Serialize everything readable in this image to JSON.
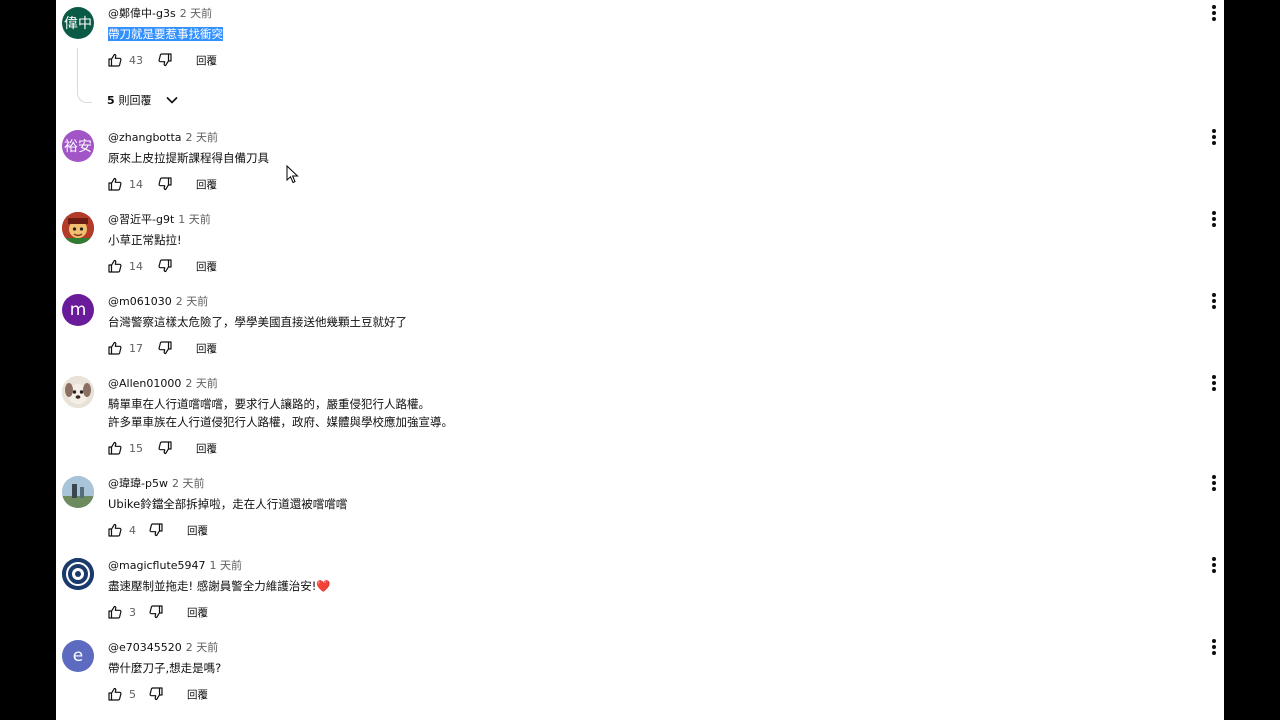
{
  "comments": [
    {
      "author": "@鄭偉中-g3s",
      "time": "2 天前",
      "lines": [
        "帶刀就是要惹事找衝突"
      ],
      "likes": "43",
      "reply_label": "回覆",
      "avatar": {
        "type": "initials",
        "text": "偉中",
        "color": "#0b5a45"
      },
      "replies_count": "5",
      "replies_label": "則回覆"
    },
    {
      "author": "@zhangbotta",
      "time": "2 天前",
      "lines": [
        "原來上皮拉提斯課程得自備刀具"
      ],
      "likes": "14",
      "reply_label": "回覆",
      "avatar": {
        "type": "initials",
        "text": "裕安",
        "color": "#a155c6"
      }
    },
    {
      "author": "@習近平-g9t",
      "time": "1 天前",
      "lines": [
        "小草正常點拉!"
      ],
      "likes": "14",
      "reply_label": "回覆",
      "avatar": {
        "type": "image",
        "icon": "cartoon-character-avatar"
      }
    },
    {
      "author": "@m061030",
      "time": "2 天前",
      "lines": [
        "台灣警察這樣太危險了，學學美國直接送他幾顆土豆就好了"
      ],
      "likes": "17",
      "reply_label": "回覆",
      "avatar": {
        "type": "letter",
        "text": "m",
        "color": "#6a1b9a"
      }
    },
    {
      "author": "@Allen01000",
      "time": "2 天前",
      "lines": [
        "騎單車在人行道嚐嚐嚐，要求行人讓路的，嚴重侵犯行人路權。",
        "許多單車族在人行道侵犯行人路權，政府、媒體與學校應加強宣導。"
      ],
      "likes": "15",
      "reply_label": "回覆",
      "avatar": {
        "type": "image",
        "icon": "dog-avatar"
      }
    },
    {
      "author": "@瑋瑋-p5w",
      "time": "2 天前",
      "lines": [
        "Ubike鈴鐺全部拆掉啦，走在人行道還被嚐嚐嚐"
      ],
      "likes": "4",
      "reply_label": "回覆",
      "avatar": {
        "type": "image",
        "icon": "landscape-avatar"
      }
    },
    {
      "author": "@magicflute5947",
      "time": "1 天前",
      "lines": [
        "盡速壓制並拖走! 感謝員警全力維護治安!"
      ],
      "emoji": "❤️",
      "likes": "3",
      "reply_label": "回覆",
      "avatar": {
        "type": "image",
        "icon": "emblem-avatar"
      }
    },
    {
      "author": "@e70345520",
      "time": "2 天前",
      "lines": [
        "帶什麼刀子,想走是嗎?"
      ],
      "likes": "5",
      "reply_label": "回覆",
      "avatar": {
        "type": "letter",
        "text": "e",
        "color": "#5c6bc0"
      }
    }
  ],
  "colors": {
    "background": "#000000",
    "panel": "#ffffff",
    "selection": "#3390ff",
    "secondary_text": "#606060"
  }
}
